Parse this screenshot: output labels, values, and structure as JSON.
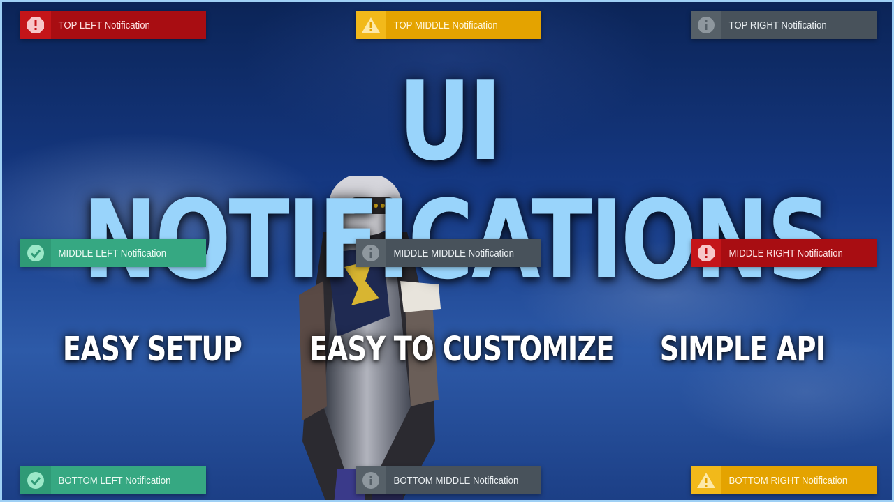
{
  "title": "UI NOTIFICATIONS",
  "features": [
    "EASY SETUP",
    "EASY TO CUSTOMIZE",
    "SIMPLE API"
  ],
  "notifications": {
    "top_left": {
      "label": "TOP LEFT Notification",
      "type": "error",
      "icon": "error-octagon-icon"
    },
    "top_middle": {
      "label": "TOP MIDDLE Notification",
      "type": "warning",
      "icon": "warning-triangle-icon"
    },
    "top_right": {
      "label": "TOP RIGHT Notification",
      "type": "info",
      "icon": "info-circle-icon"
    },
    "middle_left": {
      "label": "MIDDLE LEFT Notification",
      "type": "success",
      "icon": "check-circle-icon"
    },
    "middle_middle": {
      "label": "MIDDLE MIDDLE Notification",
      "type": "info",
      "icon": "info-circle-icon"
    },
    "middle_right": {
      "label": "MIDDLE RIGHT Notification",
      "type": "error",
      "icon": "error-octagon-icon"
    },
    "bottom_left": {
      "label": "BOTTOM LEFT Notification",
      "type": "success",
      "icon": "check-circle-icon"
    },
    "bottom_middle": {
      "label": "BOTTOM MIDDLE Notification",
      "type": "info",
      "icon": "info-circle-icon"
    },
    "bottom_right": {
      "label": "BOTTOM RIGHT Notification",
      "type": "warning",
      "icon": "warning-triangle-icon"
    }
  },
  "colors": {
    "error": "#a80d12",
    "warning": "#e4a300",
    "info": "#48525b",
    "success": "#36a882",
    "title": "#99d4fb",
    "frame_border": "#9fd0f5"
  }
}
